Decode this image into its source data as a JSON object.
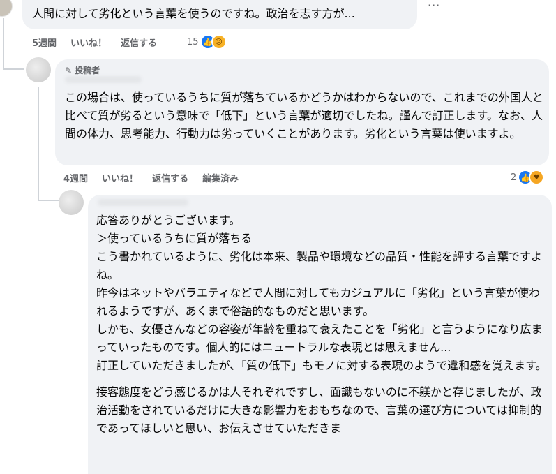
{
  "comments": [
    {
      "text": "人間に対して劣化という言葉を使うのですね。政治を志す方が...",
      "time": "5週間",
      "like_label": "いいね！",
      "reply_label": "返信する",
      "reaction_count": "15",
      "reaction_icons": [
        "like-icon",
        "sad-icon"
      ]
    },
    {
      "author_badge": "投稿者",
      "badge_icon": "pencil-icon",
      "paragraphs": [
        "この場合は、使っているうちに質が落ちているかどうかはわからないので、これまでの外国人と比べて質が劣るという意味で「低下」という言葉が適切でしたね。謹んで訂正します。なお、人間の体力、思考能力、行動力は劣っていくことがあります。劣化という言葉は使いますよ。"
      ],
      "time": "4週間",
      "like_label": "いいね！",
      "reply_label": "返信する",
      "edited_label": "編集済み",
      "reaction_count": "2",
      "reaction_icons": [
        "like-icon",
        "care-icon"
      ]
    },
    {
      "lines": [
        "応答ありがとうございます。",
        "＞使っているうちに質が落ちる",
        "こう書かれているように、劣化は本来、製品や環境などの品質・性能を評する言葉ですよね。",
        "昨今はネットやバラエティなどで人間に対してもカジュアルに「劣化」という言葉が使われるようですが、あくまで俗語的なものだと思います。",
        "しかも、女優さんなどの容姿が年齢を重ねて衰えたことを「劣化」と言うようになり広まっていったものです。個人的にはニュートラルな表現とは思えません...",
        "訂正していただきましたが、「質の低下」もモノに対する表現のようで違和感を覚えます。",
        "",
        "接客態度をどう感じるかは人それぞれですし、面識もないのに不躾かと存じましたが、政治活動をされているだけに大きな影響力をおもちなので、言葉の選び方については抑制的であってほしいと思い、お伝えさせていただきま"
      ]
    }
  ],
  "more_label": "···",
  "colors": {
    "bubble": "#f0f2f5",
    "meta": "#65676b",
    "like": "#1877f2",
    "emoji": "#f7b125"
  }
}
